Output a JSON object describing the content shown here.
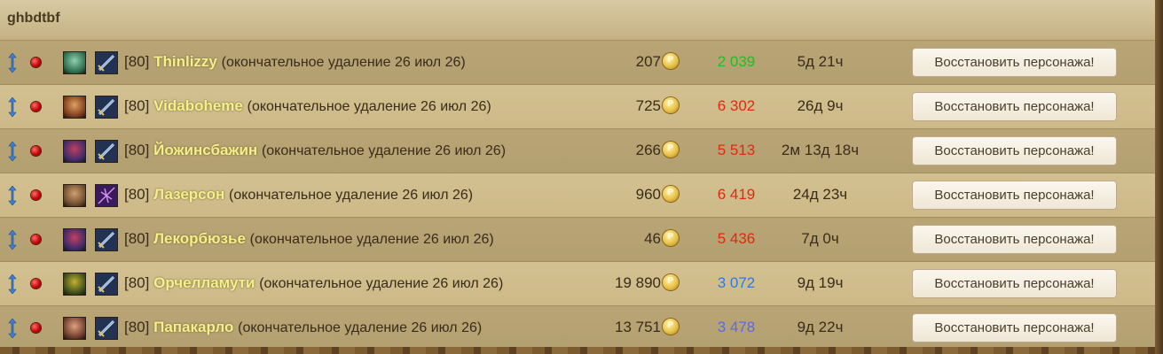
{
  "header": {
    "title": "ghbdtbf"
  },
  "level_format": "[80]",
  "restore_label": "Восстановить персонажа!",
  "colors": {
    "name": "#f5f08a",
    "rating_green": "#1fc01f",
    "rating_red": "#e02a10",
    "rating_blue": "#2f7ae0",
    "rating_purple": "#5a6ae8"
  },
  "characters": [
    {
      "level": "[80]",
      "name": "Thinlizzy",
      "deletion": "(окончательное удаление 26 июл 26)",
      "gold": "207",
      "rating": "2 039",
      "rating_color": "#1fc01f",
      "time": "5д 21ч",
      "avatar_icon": "undead-female-portrait-icon",
      "avatar_colors": [
        "#2a6a4a",
        "#8fd0b0"
      ],
      "spec_icon": "warrior-sword-icon"
    },
    {
      "level": "[80]",
      "name": "Vidaboheme",
      "deletion": "(окончательное удаление 26 июл 26)",
      "gold": "725",
      "rating": "6 302",
      "rating_color": "#e02a10",
      "time": "26д 9ч",
      "avatar_icon": "pandaren-portrait-icon",
      "avatar_colors": [
        "#7a3a1a",
        "#e0a060"
      ],
      "spec_icon": "warrior-sword-icon"
    },
    {
      "level": "[80]",
      "name": "Йожинсбажин",
      "deletion": "(окончательное удаление 26 июл 26)",
      "gold": "266",
      "rating": "5 513",
      "rating_color": "#e02a10",
      "time": "2м 13д 18ч",
      "avatar_icon": "blood-elf-portrait-icon",
      "avatar_colors": [
        "#3a2a6a",
        "#c04060"
      ],
      "spec_icon": "warrior-sword-icon"
    },
    {
      "level": "[80]",
      "name": "Лазерсон",
      "deletion": "(окончательное удаление 26 июл 26)",
      "gold": "960",
      "rating": "6 419",
      "rating_color": "#e02a10",
      "time": "24д 23ч",
      "avatar_icon": "human-female-portrait-icon",
      "avatar_colors": [
        "#6a4a2a",
        "#d0a070"
      ],
      "spec_icon": "shadow-spell-icon"
    },
    {
      "level": "[80]",
      "name": "Лекорбюзье",
      "deletion": "(окончательное удаление 26 июл 26)",
      "gold": "46",
      "rating": "5 436",
      "rating_color": "#e02a10",
      "time": "7д 0ч",
      "avatar_icon": "blood-elf-portrait-icon",
      "avatar_colors": [
        "#3a2a6a",
        "#c04060"
      ],
      "spec_icon": "warrior-sword-icon"
    },
    {
      "level": "[80]",
      "name": "Орчелламути",
      "deletion": "(окончательное удаление 26 июл 26)",
      "gold": "19 890",
      "rating": "3 072",
      "rating_color": "#2f7ae0",
      "time": "9д 19ч",
      "avatar_icon": "troll-portrait-icon",
      "avatar_colors": [
        "#3a4a1a",
        "#c0b030"
      ],
      "spec_icon": "warrior-sword-icon"
    },
    {
      "level": "[80]",
      "name": "Папакарло",
      "deletion": "(окончательное удаление 26 июл 26)",
      "gold": "13 751",
      "rating": "3 478",
      "rating_color": "#5a6ae8",
      "time": "9д 22ч",
      "avatar_icon": "gnome-portrait-icon",
      "avatar_colors": [
        "#6a3a2a",
        "#e0a080"
      ],
      "spec_icon": "warrior-sword-icon"
    }
  ]
}
